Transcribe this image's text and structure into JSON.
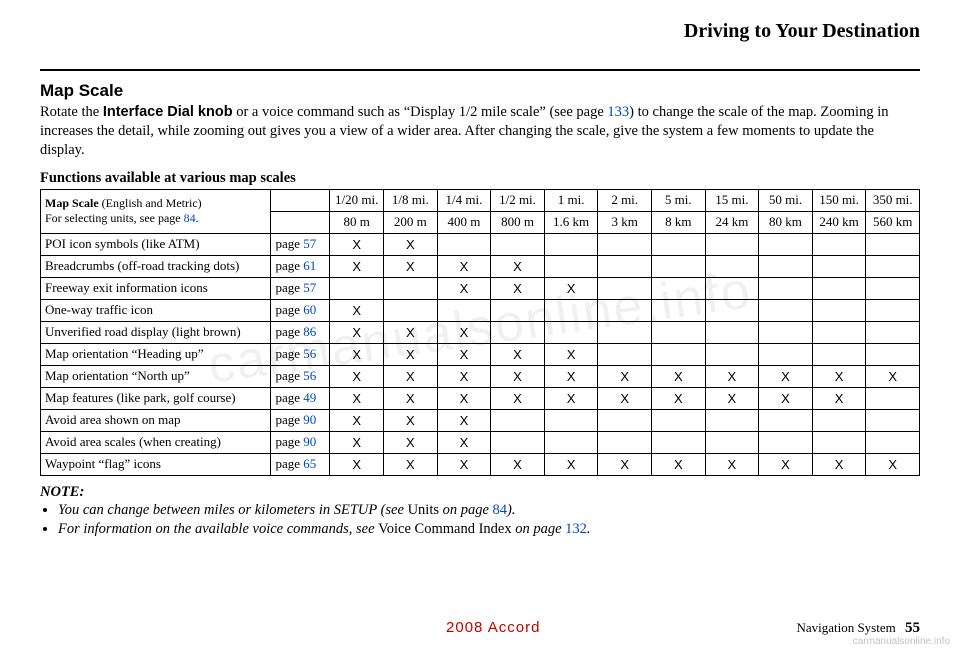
{
  "header": {
    "title": "Driving to Your Destination"
  },
  "section": {
    "heading": "Map Scale",
    "body_pre": "Rotate the ",
    "body_bold": "Interface Dial knob",
    "body_mid": " or a voice command such as “Display 1/2 mile scale” (see page ",
    "body_link": "133",
    "body_post": ") to change the scale of the map. Zooming in increases the detail, while zooming out gives you a view of a wider area. After changing the scale, give the system a few moments to update the display."
  },
  "table": {
    "caption": "Functions available at various map scales",
    "head_label_pre": "Map Scale",
    "head_label_post": " (English and Metric)",
    "head_sub_pre": "For selecting units, see page ",
    "head_sub_link": "84",
    "head_sub_post": ".",
    "scales_en": [
      "1/20 mi.",
      "1/8 mi.",
      "1/4 mi.",
      "1/2 mi.",
      "1 mi.",
      "2 mi.",
      "5 mi.",
      "15 mi.",
      "50 mi.",
      "150 mi.",
      "350 mi."
    ],
    "scales_km": [
      "80 m",
      "200 m",
      "400 m",
      "800 m",
      "1.6 km",
      "3 km",
      "8 km",
      "24 km",
      "80 km",
      "240 km",
      "560 km"
    ],
    "rows": [
      {
        "label": "POI icon symbols (like ATM)",
        "page": "57",
        "x": [
          1,
          1,
          0,
          0,
          0,
          0,
          0,
          0,
          0,
          0,
          0
        ]
      },
      {
        "label": "Breadcrumbs (off-road tracking dots)",
        "page": "61",
        "x": [
          1,
          1,
          1,
          1,
          0,
          0,
          0,
          0,
          0,
          0,
          0
        ]
      },
      {
        "label": "Freeway exit information icons",
        "page": "57",
        "x": [
          0,
          0,
          1,
          1,
          1,
          0,
          0,
          0,
          0,
          0,
          0
        ]
      },
      {
        "label": "One-way traffic icon",
        "page": "60",
        "x": [
          1,
          0,
          0,
          0,
          0,
          0,
          0,
          0,
          0,
          0,
          0
        ]
      },
      {
        "label": "Unverified road display (light brown)",
        "page": "86",
        "x": [
          1,
          1,
          1,
          0,
          0,
          0,
          0,
          0,
          0,
          0,
          0
        ]
      },
      {
        "label": "Map orientation “Heading up”",
        "page": "56",
        "x": [
          1,
          1,
          1,
          1,
          1,
          0,
          0,
          0,
          0,
          0,
          0
        ]
      },
      {
        "label": "Map orientation “North up”",
        "page": "56",
        "x": [
          1,
          1,
          1,
          1,
          1,
          1,
          1,
          1,
          1,
          1,
          1
        ]
      },
      {
        "label": "Map features (like park, golf course)",
        "page": "49",
        "x": [
          1,
          1,
          1,
          1,
          1,
          1,
          1,
          1,
          1,
          1,
          0
        ]
      },
      {
        "label": "Avoid area shown on map",
        "page": "90",
        "x": [
          1,
          1,
          1,
          0,
          0,
          0,
          0,
          0,
          0,
          0,
          0
        ]
      },
      {
        "label": "Avoid area scales (when creating)",
        "page": "90",
        "x": [
          1,
          1,
          1,
          0,
          0,
          0,
          0,
          0,
          0,
          0,
          0
        ]
      },
      {
        "label": "Waypoint “flag” icons",
        "page": "65",
        "x": [
          1,
          1,
          1,
          1,
          1,
          1,
          1,
          1,
          1,
          1,
          1
        ]
      }
    ],
    "page_prefix": "page "
  },
  "note": {
    "label": "NOTE:",
    "items": [
      {
        "pre": "You can change between miles or kilometers in SETUP (see ",
        "roman": "Units",
        "mid": " on page ",
        "link": "84",
        "post": ")."
      },
      {
        "pre": "For information on the available voice commands, see ",
        "roman": "Voice Command Index",
        "mid": " on page ",
        "link": "132",
        "post": "."
      }
    ]
  },
  "footer": {
    "model": "2008  Accord",
    "label": "Navigation System",
    "page": "55"
  },
  "watermark": "carmanualsonline.info",
  "watermark_small": "carmanualsonline.info"
}
